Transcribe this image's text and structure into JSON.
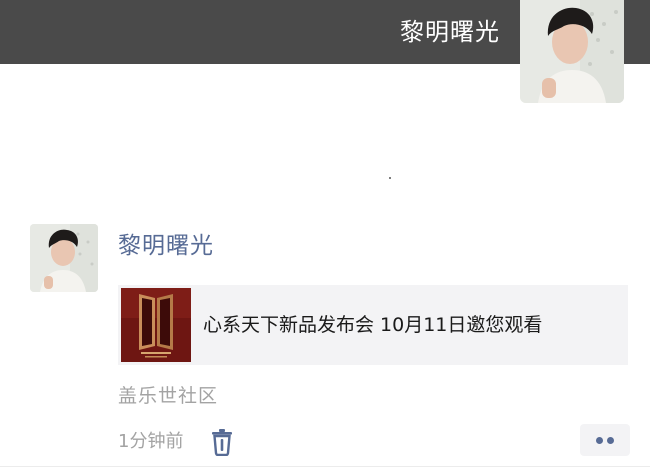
{
  "header": {
    "username": "黎明曙光",
    "avatar_icon": "user-avatar-photo"
  },
  "post": {
    "author": "黎明曙光",
    "avatar_icon": "user-avatar-photo",
    "link": {
      "title": "心系天下新品发布会 10月11日邀您观看",
      "thumbnail_icon": "event-poster-thumbnail"
    },
    "source": "盖乐世社区",
    "time": "1分钟前",
    "delete_icon": "trash-icon",
    "more_icon": "more-dots-icon"
  },
  "colors": {
    "header_bg": "#4a4a4a",
    "name_link": "#576b95",
    "muted_text": "#a3a3a3",
    "card_bg": "#f3f3f5"
  }
}
